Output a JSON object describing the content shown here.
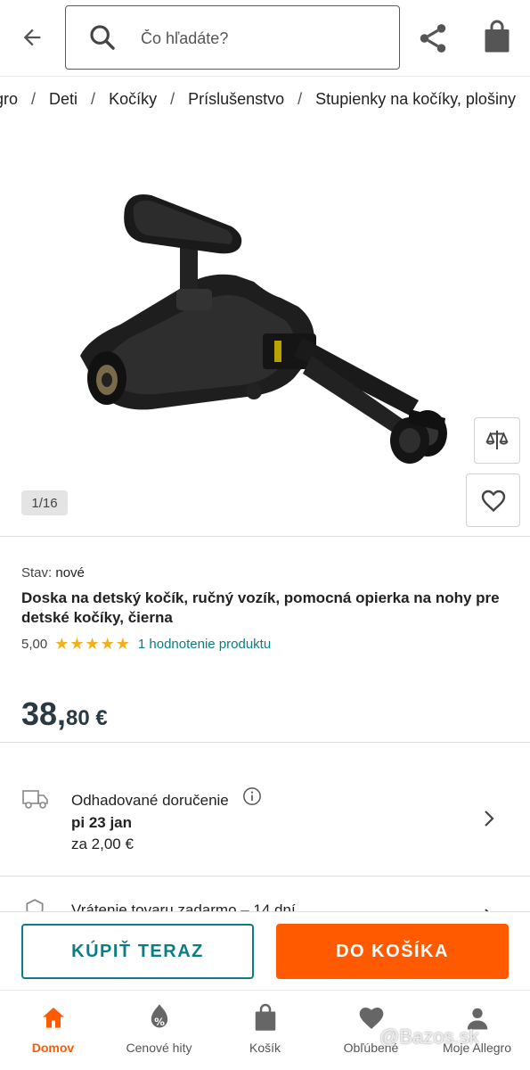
{
  "header": {
    "search": {
      "placeholder": "Čo hľadáte?"
    }
  },
  "breadcrumb": [
    "gro",
    "Deti",
    "Kočíky",
    "Príslušenstvo",
    "Stupienky na kočíky, plošiny"
  ],
  "gallery": {
    "counter": "1/16"
  },
  "product": {
    "condition_label": "Stav:",
    "condition_value": "nové",
    "title": "Doska na detský kočík, ručný vozík, pomocná opierka na nohy pre detské kočíky, čierna",
    "rating": {
      "score": "5,00",
      "stars": 5,
      "stars_text": "★★★★★",
      "link": "1 hodnotenie produktu"
    },
    "price": {
      "integer": "38,",
      "decimal": "80 €"
    }
  },
  "delivery": {
    "title": "Odhadované doručenie",
    "date": "pi 23 jan",
    "price": "za 2,00 €"
  },
  "returns": {
    "text": "Vrátenie tovaru zadarmo – 14 dní"
  },
  "actions": {
    "buy_now": "KÚPIŤ TERAZ",
    "add_to_cart": "DO KOŠÍKA"
  },
  "bottom_nav": [
    {
      "label": "Domov",
      "icon": "home-icon",
      "active": true
    },
    {
      "label": "Cenové hity",
      "icon": "percent-tag-icon",
      "active": false
    },
    {
      "label": "Košík",
      "icon": "cart-icon",
      "active": false
    },
    {
      "label": "Obľúbené",
      "icon": "heart-icon",
      "active": false
    },
    {
      "label": "Moje Allegro",
      "icon": "user-icon",
      "active": false
    }
  ],
  "watermark": "@Bazos.sk",
  "colors": {
    "accent_teal": "#0b7d84",
    "accent_orange": "#ff5a00",
    "star": "#f2b01e"
  }
}
